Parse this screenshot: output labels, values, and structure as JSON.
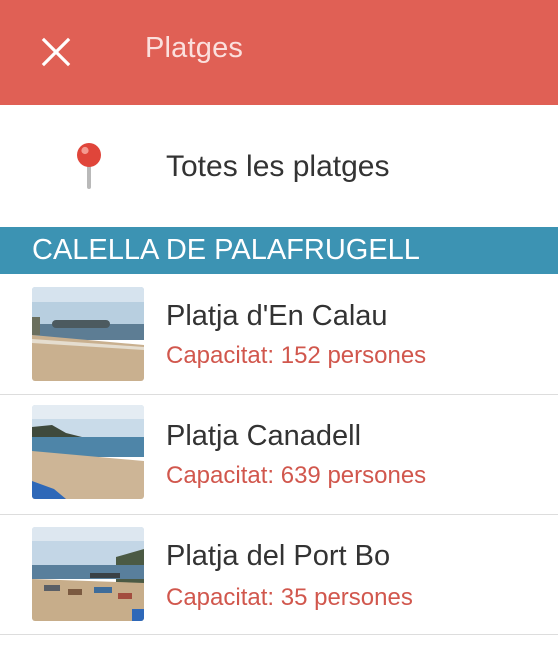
{
  "colors": {
    "appbar": "#e06055",
    "section_header": "#3c93b3",
    "capacity_text": "#d1574d"
  },
  "header": {
    "close_icon": "close-icon",
    "title": "Platges"
  },
  "all_beaches": {
    "icon": "map-pin-icon",
    "label": "Totes les platges"
  },
  "section": {
    "title": "CALELLA DE PALAFRUGELL"
  },
  "beaches": [
    {
      "name": "Platja d'En Calau",
      "capacity": "Capacitat: 152 persones"
    },
    {
      "name": "Platja Canadell",
      "capacity": "Capacitat: 639 persones"
    },
    {
      "name": "Platja del Port Bo",
      "capacity": "Capacitat: 35 persones"
    }
  ]
}
